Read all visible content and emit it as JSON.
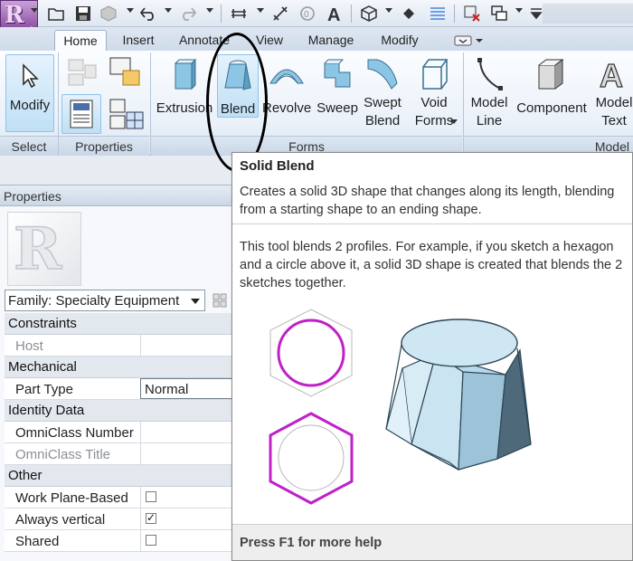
{
  "colors": {
    "accent": "#8b3a9d",
    "profile_magenta": "#c020c8",
    "shape_fill": "#bcdcec"
  },
  "qat": {
    "icons": [
      "open-icon",
      "save-icon",
      "sync-icon",
      "undo-icon",
      "redo-icon",
      "measure-icon",
      "dimension-icon",
      "tag-icon",
      "text-icon",
      "3d-view-icon",
      "section-icon",
      "thin-lines-icon",
      "close-hidden-icon",
      "switch-windows-icon",
      "customize-icon"
    ]
  },
  "tabs": [
    {
      "label": "Home",
      "active": true
    },
    {
      "label": "Insert",
      "active": false
    },
    {
      "label": "Annotate",
      "active": false
    },
    {
      "label": "View",
      "active": false
    },
    {
      "label": "Manage",
      "active": false
    },
    {
      "label": "Modify",
      "active": false
    }
  ],
  "ribbon": {
    "panels": {
      "select": "Select",
      "properties": "Properties",
      "forms": "Forms",
      "model": "Model"
    },
    "buttons": {
      "modify": "Modify",
      "extrusion": "Extrusion",
      "blend": "Blend",
      "revolve": "Revolve",
      "sweep": "Sweep",
      "swept_blend_1": "Swept",
      "swept_blend_2": "Blend",
      "void_forms_1": "Void",
      "void_forms_2": "Forms",
      "model_line_1": "Model",
      "model_line_2": "Line",
      "component": "Component",
      "model_text_1": "Model",
      "model_text_2": "Text"
    }
  },
  "properties": {
    "header": "Properties",
    "family": "Family: Specialty Equipment",
    "rows": [
      {
        "type": "group",
        "label": "Constraints"
      },
      {
        "type": "param",
        "label": "Host",
        "dim": true,
        "value": ""
      },
      {
        "type": "group",
        "label": "Mechanical"
      },
      {
        "type": "param",
        "label": "Part Type",
        "value": "Normal",
        "input": true
      },
      {
        "type": "group",
        "label": "Identity Data"
      },
      {
        "type": "param",
        "label": "OmniClass Number",
        "value": ""
      },
      {
        "type": "param",
        "label": "OmniClass Title",
        "dim": true,
        "value": ""
      },
      {
        "type": "group",
        "label": "Other"
      },
      {
        "type": "check",
        "label": "Work Plane-Based",
        "checked": false
      },
      {
        "type": "check",
        "label": "Always vertical",
        "checked": true
      },
      {
        "type": "check",
        "label": "Shared",
        "checked": false
      }
    ]
  },
  "tooltip": {
    "title": "Solid Blend",
    "description": "Creates a solid 3D shape that changes along its length, blending from a starting shape to an ending shape.",
    "detail": "This tool blends 2 profiles. For example, if you sketch a hexagon and a circle above it, a solid 3D shape is created that blends the 2 sketches together.",
    "footer": "Press F1 for more help"
  }
}
